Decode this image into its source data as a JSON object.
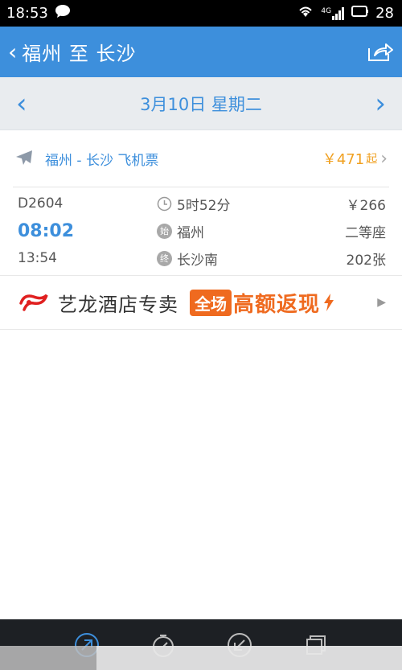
{
  "status": {
    "time": "18:53",
    "network": "4G",
    "battery": "28"
  },
  "header": {
    "title": "福州 至 长沙"
  },
  "date_nav": {
    "date": "3月10日 星期二"
  },
  "flight": {
    "title": "福州 - 长沙 飞机票",
    "price": "￥471",
    "price_suffix": "起"
  },
  "train": {
    "number": "D2604",
    "depart_time": "08:02",
    "arrive_time": "13:54",
    "duration": "5时52分",
    "from_badge": "始",
    "from": "福州",
    "to_badge": "终",
    "to": "长沙南",
    "price": "￥266",
    "seat_class": "二等座",
    "tickets": "202张"
  },
  "banner": {
    "brand": "艺龙酒店专卖",
    "tag": "全场",
    "promo": "高额返现"
  },
  "colors": {
    "accent": "#3d8fdc",
    "price": "#f0a020",
    "promo": "#ef6a1f",
    "tabbar": "#1d2024"
  },
  "icons": {
    "tabs": [
      "depart-icon",
      "timer-icon",
      "arrive-icon",
      "ticket-icon"
    ]
  }
}
